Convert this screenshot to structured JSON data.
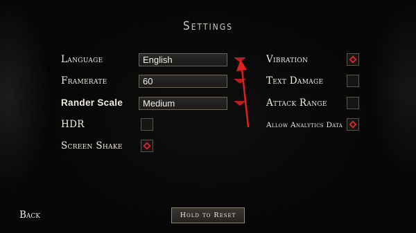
{
  "title": "Settings",
  "left_settings": [
    {
      "label": "Language",
      "type": "dropdown",
      "value": "English"
    },
    {
      "label": "Framerate",
      "type": "dropdown",
      "value": "60"
    },
    {
      "label": "Rander Scale",
      "type": "dropdown",
      "value": "Medium"
    },
    {
      "label": "HDR",
      "type": "checkbox",
      "checked": false
    },
    {
      "label": "Screen Shake",
      "type": "checkbox",
      "checked": true
    }
  ],
  "right_settings": [
    {
      "label": "Vibration",
      "checked": true
    },
    {
      "label": "Text Damage",
      "checked": false
    },
    {
      "label": "Attack Range",
      "checked": false
    },
    {
      "label": "Allow Analytics Data",
      "checked": true
    }
  ],
  "reset_label": "Hold to Reset",
  "back_label": "Back",
  "colors": {
    "accent": "#d2272c",
    "arrow": "#b51f24",
    "annotation": "#e0201f"
  }
}
